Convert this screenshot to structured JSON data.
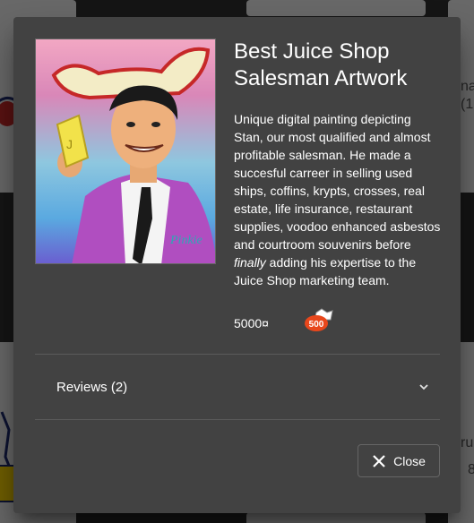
{
  "product": {
    "title": "Best Juice Shop Salesman Artwork",
    "description_before": "Unique digital painting depicting Stan, our most qualified and almost profitable salesman. He made a succesful carreer in selling used ships, coffins, krypts, crosses, real estate, life insurance, restaurant supplies, voodoo enhanced asbestos and courtroom souvenirs before ",
    "description_emphasis": "finally",
    "description_after": " adding his expertise to the Juice Shop marketing team.",
    "price": "5000¤",
    "badge_value": "500",
    "image_signature": "Pinkie"
  },
  "reviews": {
    "label": "Reviews (2)"
  },
  "actions": {
    "close_label": "Close"
  },
  "background": {
    "right_top_text": "na",
    "right_top_sub": "(1",
    "right_bottom_text": "ru",
    "right_bottom_sub": "8"
  },
  "colors": {
    "dialog_bg": "#424242",
    "badge_accent": "#e8471c"
  }
}
